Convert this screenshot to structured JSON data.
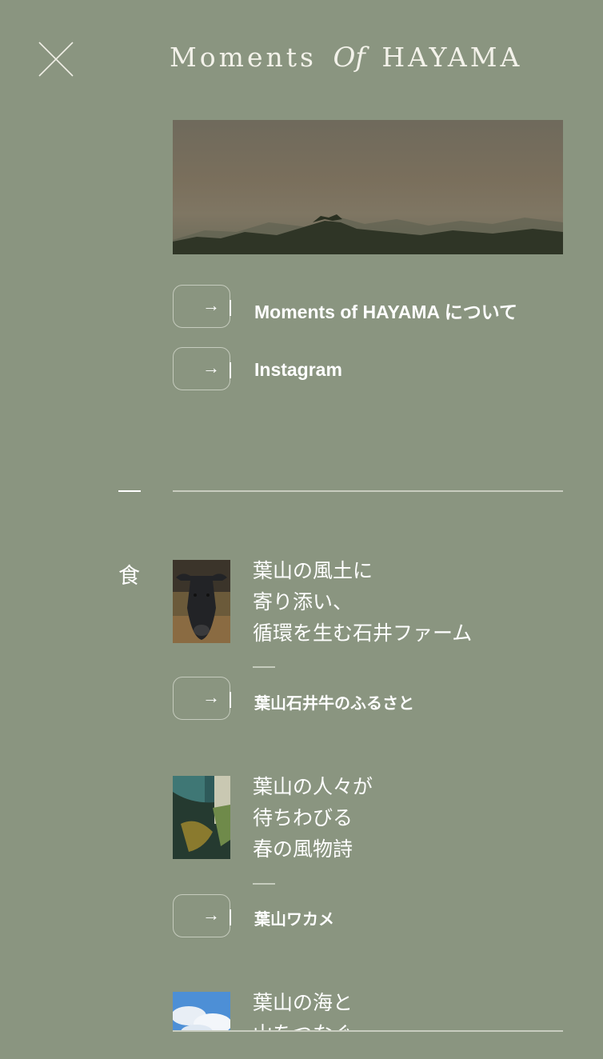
{
  "header": {
    "logo_left": "Moments",
    "logo_of": "Of",
    "logo_right": "HAYAMA",
    "close_icon": "close-icon"
  },
  "links": [
    {
      "label": "Moments of HAYAMA について",
      "icon": "arrow-right-icon"
    },
    {
      "label": "Instagram",
      "icon": "arrow-right-icon"
    }
  ],
  "category": {
    "label": "食",
    "articles": [
      {
        "title_lines": [
          "葉山の風土に",
          "寄り添い、",
          "循環を生む石井ファーム"
        ],
        "link_label": "葉山石井牛のふるさと",
        "thumb": "cow-photo"
      },
      {
        "title_lines": [
          "葉山の人々が",
          "待ちわびる",
          "春の風物詩"
        ],
        "link_label": "葉山ワカメ",
        "thumb": "seaweed-photo"
      },
      {
        "title_lines": [
          "葉山の海と",
          "山をつなぐ"
        ],
        "thumb": "sky-photo"
      }
    ]
  },
  "colors": {
    "background": "#8a9580",
    "border": "#c5cbbd",
    "text": "#ffffff"
  }
}
